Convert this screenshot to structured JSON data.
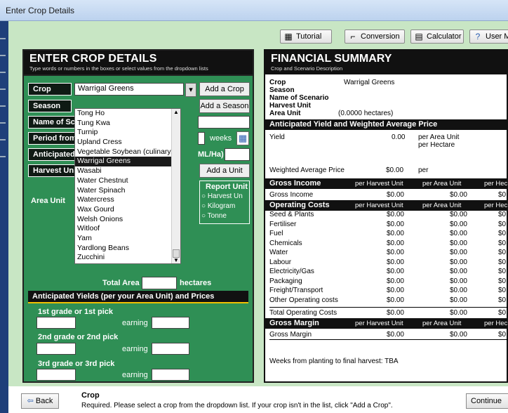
{
  "window": {
    "title": "Enter Crop Details"
  },
  "toolbar": {
    "tutorial": "Tutorial",
    "conversion": "Conversion",
    "calculator": "Calculator",
    "user_manual": "User Ma"
  },
  "left": {
    "title": "ENTER CROP DETAILS",
    "subtitle": "Type words or numbers in the boxes or select values from the dropdown lists",
    "crop_label": "Crop",
    "crop_value": "Warrigal Greens",
    "add_crop": "Add a Crop",
    "season_label": "Season",
    "add_season": "Add a Season",
    "scenario_label": "Name of Sce",
    "period_label": "Period from",
    "weeks": "weeks",
    "anticipated_label": "Anticipated",
    "ml_ha": "ML/Ha)",
    "harvest_label": "Harvest Unit",
    "add_unit": "Add a Unit",
    "report_unit": "Report Unit",
    "report_options": [
      "Harvest Un",
      "Kilogram",
      "Tonne"
    ],
    "area_label": "Area Unit",
    "total_area": "Total Area",
    "hectares": "hectares",
    "crop_options": [
      "Tong Ho",
      "Tung Kwa",
      "Turnip",
      "Upland Cress",
      "Vegetable Soybean (culinary,",
      "Warrigal Greens",
      "Wasabi",
      "Water Chestnut",
      "Water Spinach",
      "Watercress",
      "Wax Gourd",
      "Welsh Onions",
      "Witloof",
      "Yam",
      "Yardlong Beans",
      "Zucchini"
    ],
    "yields_header": "Anticipated Yields (per your Area Unit) and Prices",
    "grades": [
      "1st grade or 1st pick",
      "2nd grade or 2nd pick",
      "3rd grade or 3rd pick"
    ],
    "earning": "earning"
  },
  "right": {
    "title": "FINANCIAL SUMMARY",
    "subtitle": "Crop and Scenario Description",
    "crop_label": "Crop",
    "crop_value": "Warrigal Greens",
    "season": "Season",
    "scenario": "Name of Scenario",
    "harvest_unit": "Harvest Unit",
    "area_unit": "Area Unit",
    "area_value": "(0.0000 hectares)",
    "yield_header": "Anticipated Yield and Weighted Average Price",
    "yield_label": "Yield",
    "yield_value": "0.00",
    "per_area": "per Area Unit",
    "per_hectare": "per Hectare",
    "wap_label": "Weighted Average Price",
    "wap_value": "$0.00",
    "wap_per": "per",
    "col_harvest": "per Harvest Unit",
    "col_area": "per Area Unit",
    "col_hec": "per Hec",
    "gross_income_header": "Gross Income",
    "gross_income": {
      "label": "Gross Income",
      "h": "$0.00",
      "a": "$0.00",
      "e": "$0"
    },
    "op_header": "Operating Costs",
    "op_rows": [
      {
        "label": "Seed & Plants",
        "h": "$0.00",
        "a": "$0.00",
        "e": "$0"
      },
      {
        "label": "Fertiliser",
        "h": "$0.00",
        "a": "$0.00",
        "e": "$0"
      },
      {
        "label": "Fuel",
        "h": "$0.00",
        "a": "$0.00",
        "e": "$0"
      },
      {
        "label": "Chemicals",
        "h": "$0.00",
        "a": "$0.00",
        "e": "$0"
      },
      {
        "label": "Water",
        "h": "$0.00",
        "a": "$0.00",
        "e": "$0"
      },
      {
        "label": "Labour",
        "h": "$0.00",
        "a": "$0.00",
        "e": "$0"
      },
      {
        "label": "Electricity/Gas",
        "h": "$0.00",
        "a": "$0.00",
        "e": "$0"
      },
      {
        "label": "Packaging",
        "h": "$0.00",
        "a": "$0.00",
        "e": "$0"
      },
      {
        "label": "Freight/Transport",
        "h": "$0.00",
        "a": "$0.00",
        "e": "$0"
      },
      {
        "label": "Other Operating costs",
        "h": "$0.00",
        "a": "$0.00",
        "e": "$0"
      }
    ],
    "total_op": {
      "label": "Total Operating Costs",
      "h": "$0.00",
      "a": "$0.00",
      "e": "$0"
    },
    "gm_header": "Gross Margin",
    "gross_margin": {
      "label": "Gross Margin",
      "h": "$0.00",
      "a": "$0.00",
      "e": "$0"
    },
    "weeks_text": "Weeks from planting to final harvest: TBA"
  },
  "footer": {
    "back": "Back",
    "heading": "Crop",
    "message": "Required. Please select a crop from the dropdown list. If your crop isn't in the list, click \"Add a Crop\".",
    "continue": "Continue"
  }
}
